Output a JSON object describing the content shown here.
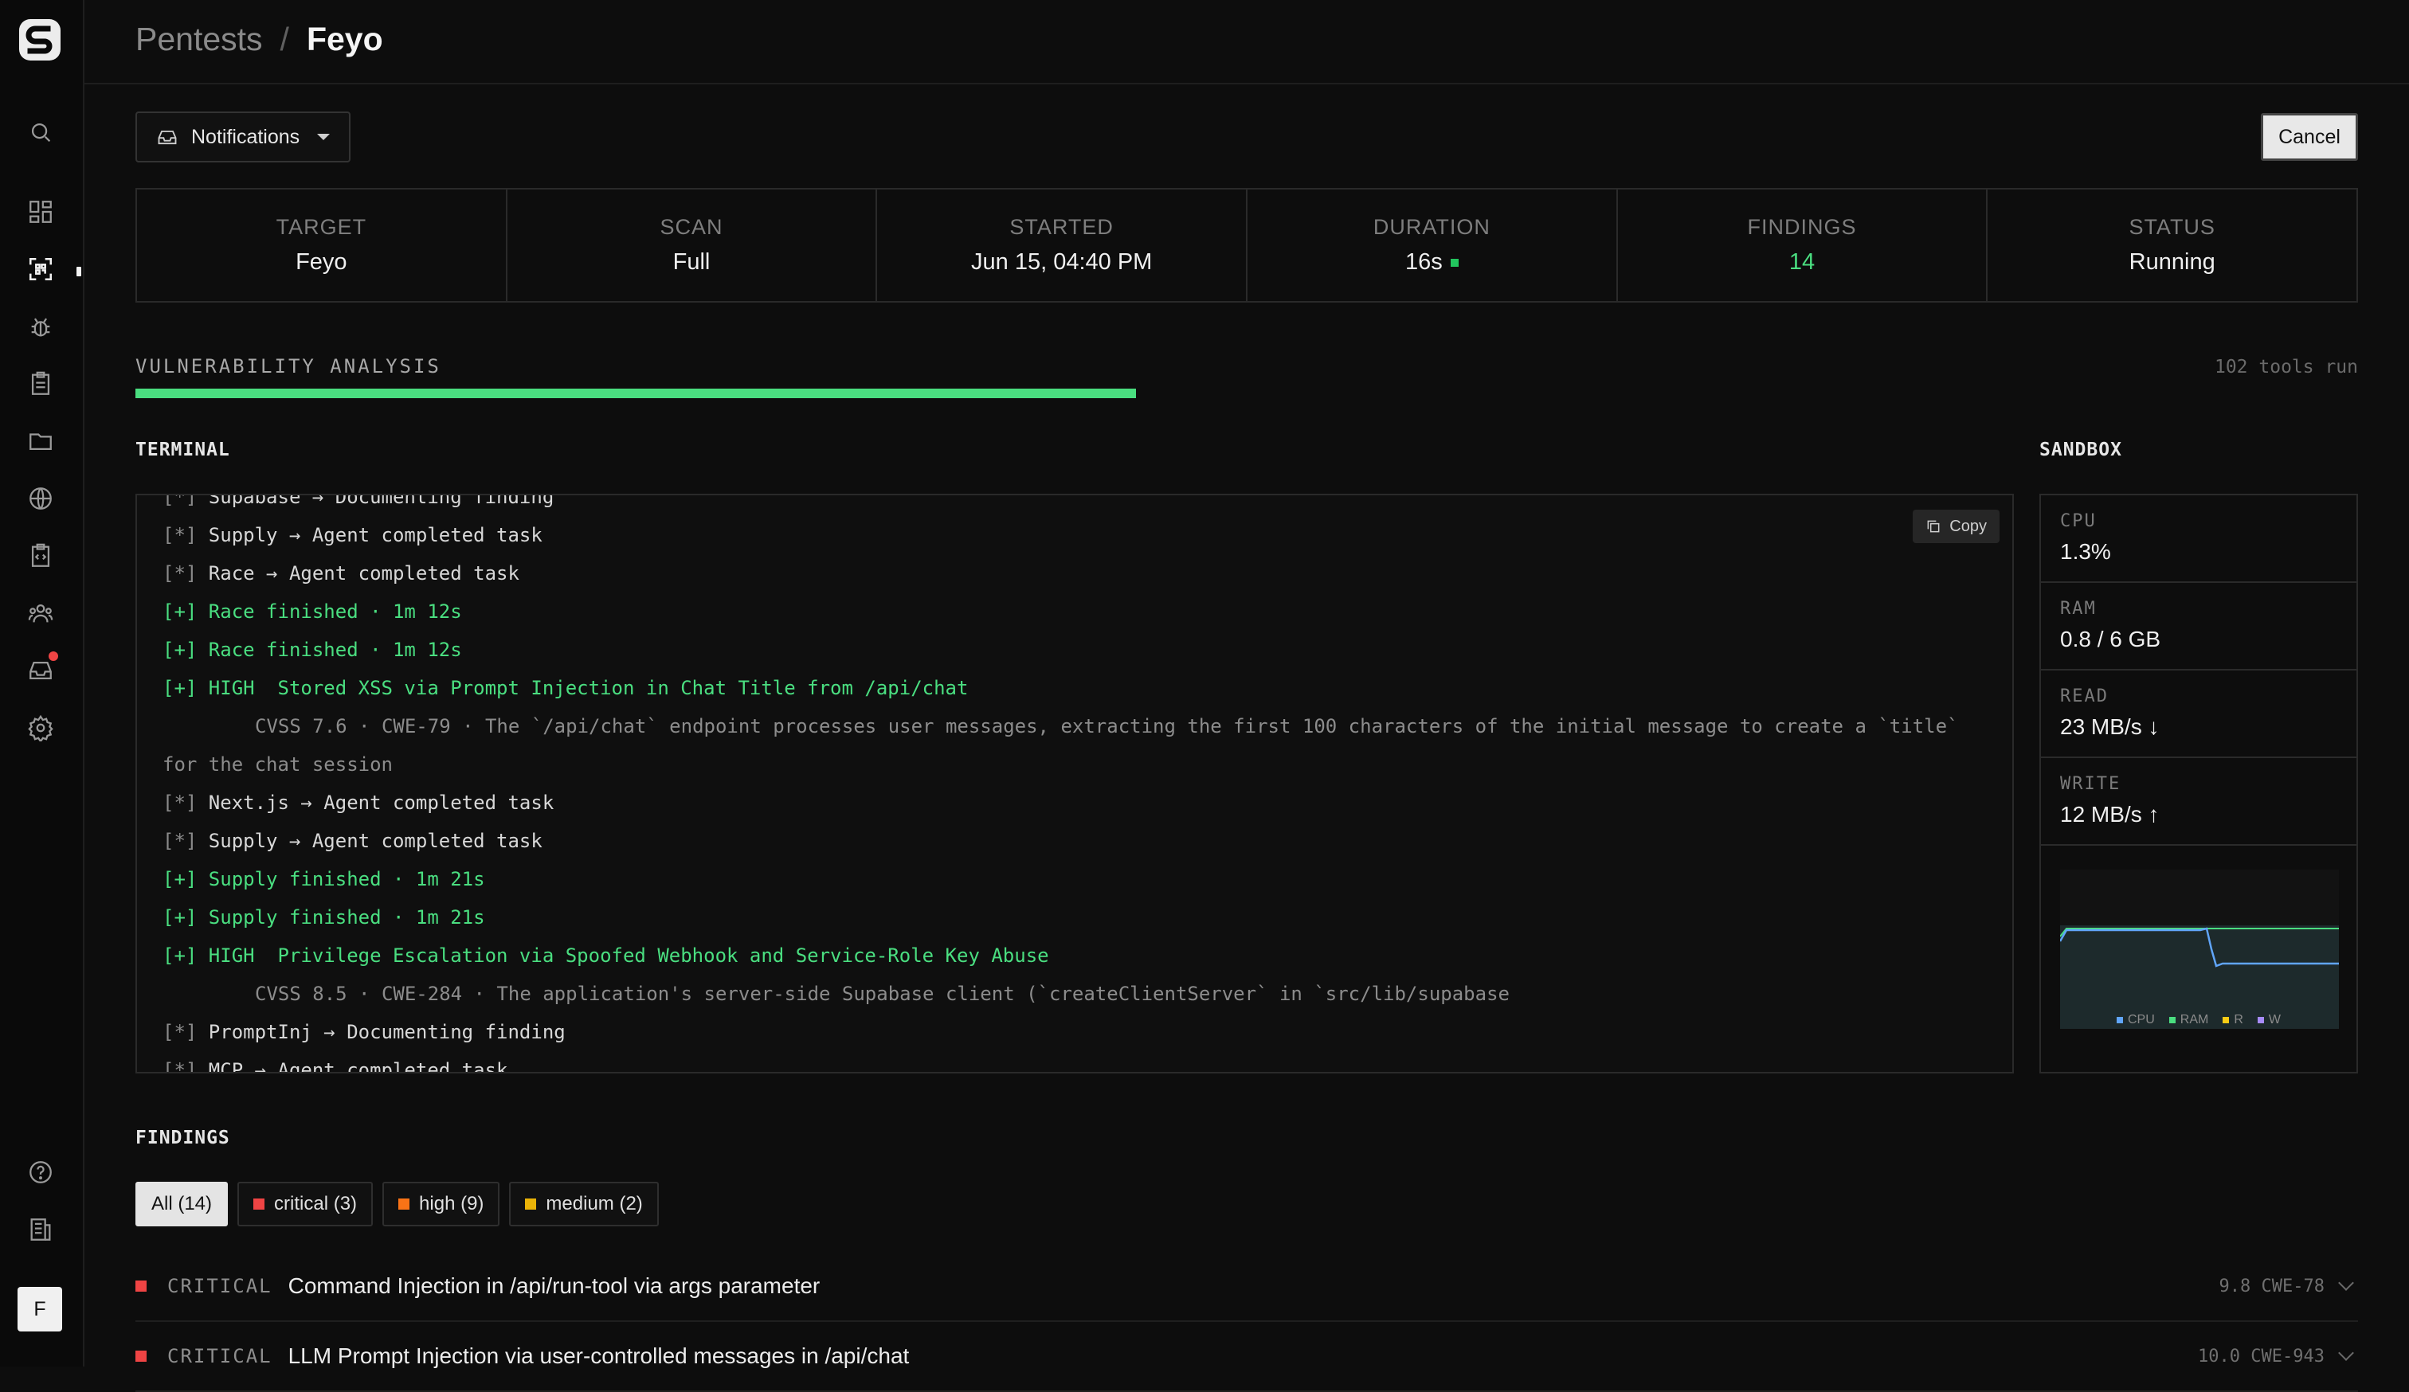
{
  "breadcrumb": {
    "parent": "Pentests",
    "separator": "/",
    "current": "Feyo"
  },
  "toolbar": {
    "notifications_label": "Notifications",
    "cancel_label": "Cancel"
  },
  "stats": [
    {
      "label": "TARGET",
      "value": "Feyo"
    },
    {
      "label": "SCAN",
      "value": "Full"
    },
    {
      "label": "STARTED",
      "value": "Jun 15, 04:40 PM"
    },
    {
      "label": "DURATION",
      "value": "16s"
    },
    {
      "label": "FINDINGS",
      "value": "14"
    },
    {
      "label": "STATUS",
      "value": "Running"
    }
  ],
  "progress": {
    "phase": "VULNERABILITY ANALYSIS",
    "tools_run": "102 tools run",
    "fraction": 0.45
  },
  "terminal": {
    "title": "TERMINAL",
    "copy_label": "Copy",
    "lines": [
      {
        "tag": "[*]",
        "text": "Supabase → Documenting finding"
      },
      {
        "tag": "[*]",
        "text": "Supply → Agent completed task"
      },
      {
        "tag": "[*]",
        "text": "Race → Agent completed task"
      },
      {
        "tag": "[+]",
        "text": "Race finished · 1m 12s"
      },
      {
        "tag": "[+]",
        "text": "Race finished · 1m 12s"
      },
      {
        "tag": "[+]",
        "text": "HIGH  Stored XSS via Prompt Injection in Chat Title from /api/chat"
      },
      {
        "text": "CVSS 7.6 · CWE-79 · The `/api/chat` endpoint processes user messages, extracting the first 100 characters of the initial message to create a `title` for the chat session"
      },
      {
        "tag": "[*]",
        "text": "Next.js → Agent completed task"
      },
      {
        "tag": "[*]",
        "text": "Supply → Agent completed task"
      },
      {
        "tag": "[+]",
        "text": "Supply finished · 1m 21s"
      },
      {
        "tag": "[+]",
        "text": "Supply finished · 1m 21s"
      },
      {
        "tag": "[+]",
        "text": "HIGH  Privilege Escalation via Spoofed Webhook and Service-Role Key Abuse"
      },
      {
        "text": "CVSS 8.5 · CWE-284 · The application's server-side Supabase client (`createClientServer` in `src/lib/supabase"
      },
      {
        "tag": "[*]",
        "text": "PromptInj → Documenting finding"
      },
      {
        "tag": "[*]",
        "text": "MCP → Agent completed task"
      }
    ]
  },
  "sandbox": {
    "title": "SANDBOX",
    "metrics": [
      {
        "label": "CPU",
        "value": "1.3%"
      },
      {
        "label": "RAM",
        "value": "0.8 / 6 GB"
      },
      {
        "label": "READ",
        "value": "23 MB/s ↓"
      },
      {
        "label": "WRITE",
        "value": "12 MB/s ↑"
      }
    ],
    "legend": [
      {
        "name": "CPU",
        "color": "#60a5fa"
      },
      {
        "name": "RAM",
        "color": "#4ade80"
      },
      {
        "name": "R",
        "color": "#facc15"
      },
      {
        "name": "W",
        "color": "#a78bfa"
      }
    ]
  },
  "findings": {
    "title": "FINDINGS",
    "filters": [
      {
        "label": "All (14)",
        "color": null
      },
      {
        "label": "critical (3)",
        "color": "#ef4444"
      },
      {
        "label": "high (9)",
        "color": "#f97316"
      },
      {
        "label": "medium (2)",
        "color": "#eab308"
      }
    ],
    "items": [
      {
        "severity": "CRITICAL",
        "title": "Command Injection in /api/run-tool via args parameter",
        "meta": "9.8 CWE-78"
      },
      {
        "severity": "CRITICAL",
        "title": "LLM Prompt Injection via user-controlled messages in /api/chat",
        "meta": "10.0 CWE-943"
      }
    ]
  },
  "rail": {
    "avatar_initial": "F"
  },
  "colors": {
    "accent": "#4ade80",
    "critical": "#ef4444",
    "high": "#f97316",
    "medium": "#eab308"
  }
}
